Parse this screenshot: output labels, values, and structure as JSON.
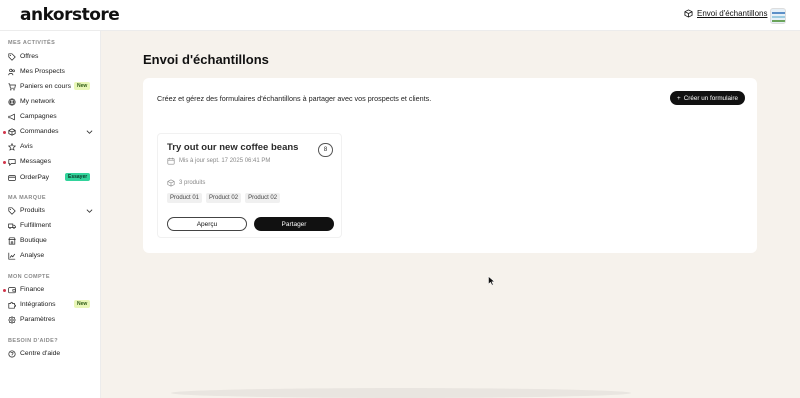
{
  "app": {
    "logo": "ankorstore"
  },
  "topbar": {
    "link_label": "Envoi d'échantillons",
    "link_icon": "box-icon"
  },
  "sidebar": {
    "sections": [
      {
        "label": "MES ACTIVITÉS",
        "items": [
          {
            "label": "Offres",
            "icon": "tag-icon"
          },
          {
            "label": "Mes Prospects",
            "icon": "users-icon"
          },
          {
            "label": "Paniers en cours",
            "icon": "cart-icon",
            "badge": "New"
          },
          {
            "label": "My network",
            "icon": "globe-icon"
          },
          {
            "label": "Campagnes",
            "icon": "megaphone-icon"
          },
          {
            "label": "Commandes",
            "icon": "box-icon",
            "has_dot": true,
            "has_chevron": true
          },
          {
            "label": "Avis",
            "icon": "star-icon"
          },
          {
            "label": "Messages",
            "icon": "chat-icon",
            "has_dot": true
          },
          {
            "label": "OrderPay",
            "icon": "card-icon",
            "badge": "Essayer"
          }
        ]
      },
      {
        "label": "MA MARQUE",
        "items": [
          {
            "label": "Produits",
            "icon": "tag-icon",
            "has_chevron": true
          },
          {
            "label": "Fulfillment",
            "icon": "truck-icon"
          },
          {
            "label": "Boutique",
            "icon": "shop-icon"
          },
          {
            "label": "Analyse",
            "icon": "chart-icon"
          }
        ]
      },
      {
        "label": "MON COMPTE",
        "items": [
          {
            "label": "Finance",
            "icon": "wallet-icon",
            "has_dot": true
          },
          {
            "label": "Intégrations",
            "icon": "puzzle-icon",
            "badge": "New"
          },
          {
            "label": "Paramètres",
            "icon": "gear-icon"
          }
        ]
      },
      {
        "label": "BESOIN D'AIDE?",
        "items": [
          {
            "label": "Centre d'aide",
            "icon": "help-icon"
          }
        ]
      }
    ]
  },
  "main": {
    "title": "Envoi d'échantillons",
    "description": "Créez et gérez des formulaires d'échantillons à partager avec vos prospects et clients.",
    "create_button": "Créer un formulaire",
    "card": {
      "title": "Try out our new coffee beans",
      "updated": "Mis à jour sept. 17 2025 06:41 PM",
      "badge": "8",
      "product_count": "3 produits",
      "products": [
        "Product 01",
        "Product 02",
        "Product 02"
      ],
      "preview_button": "Aperçu",
      "share_button": "Partager"
    }
  },
  "colors": {
    "main_background": "#f6f2ec",
    "accent_dark": "#111111",
    "badge_new": "#e9f7b8",
    "badge_try": "#32d39b",
    "notification_dot": "#d1344a"
  }
}
